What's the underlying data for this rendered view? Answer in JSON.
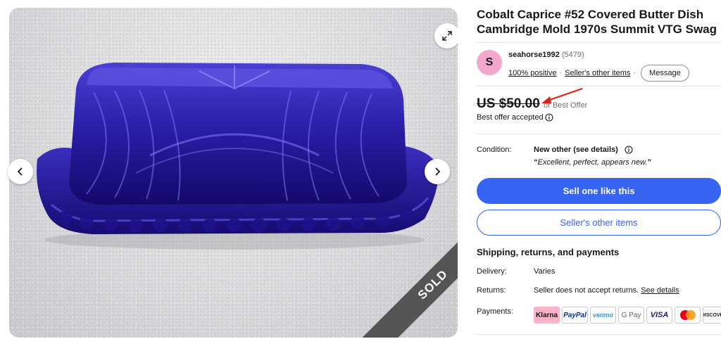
{
  "listing": {
    "title": "Cobalt Caprice #52 Covered Butter Dish Cambridge Mold 1970s Summit VTG Swag",
    "image": {
      "badge": "SOLD",
      "expand_icon": "expand-icon",
      "prev_icon": "chevron-left-icon",
      "next_icon": "chevron-right-icon"
    }
  },
  "seller": {
    "avatar_letter": "S",
    "name": "seahorse1992",
    "feedback_count": "(5479)",
    "positive": "100% positive",
    "other_items_link": "Seller's other items",
    "message_label": "Message"
  },
  "price": {
    "amount": "US $50.00",
    "suffix": "or Best Offer",
    "offer_status": "Best offer accepted"
  },
  "condition": {
    "label": "Condition:",
    "value": "New other (see details)",
    "quote": "Excellent, perfect, appears new."
  },
  "actions": {
    "sell_one": "Sell one like this",
    "other_items": "Seller's other items"
  },
  "shipping": {
    "heading": "Shipping, returns, and payments",
    "delivery_label": "Delivery:",
    "delivery_value": "Varies",
    "returns_label": "Returns:",
    "returns_value": "Seller does not accept returns.",
    "returns_link": "See details",
    "payments_label": "Payments:",
    "payment_methods": [
      "Klarna",
      "PayPal",
      "venmo",
      "G Pay",
      "VISA",
      "Mastercard",
      "DISCOVER"
    ]
  },
  "colors": {
    "accent": "#3665f3",
    "avatar": "#f2a7cf",
    "sold_ribbon": "#555555",
    "annotation_arrow": "#e0201b"
  }
}
